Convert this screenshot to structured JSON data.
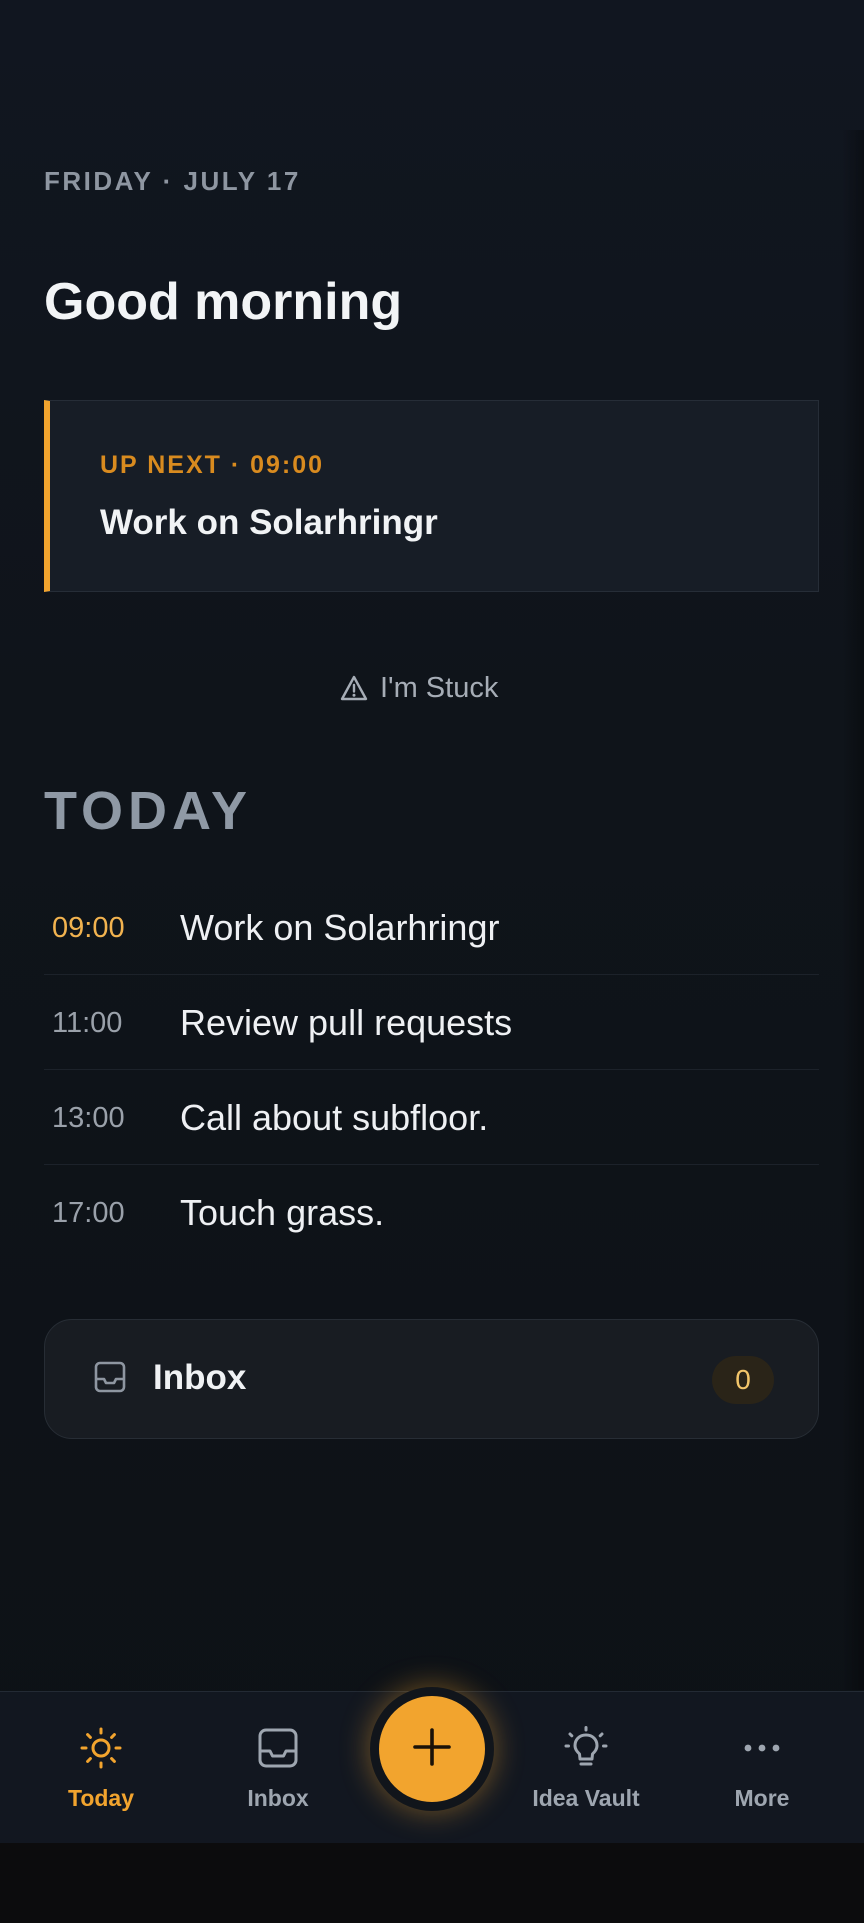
{
  "header": {
    "date": "FRIDAY · JULY 17",
    "greeting": "Good morning"
  },
  "up_next": {
    "label": "UP NEXT · 09:00",
    "title": "Work on Solarhringr"
  },
  "stuck_button": {
    "label": "I'm Stuck",
    "icon": "warning-triangle-icon"
  },
  "today": {
    "heading": "TODAY",
    "items": [
      {
        "time": "09:00",
        "title": "Work on Solarhringr",
        "current": true
      },
      {
        "time": "11:00",
        "title": "Review pull requests",
        "current": false
      },
      {
        "time": "13:00",
        "title": "Call about subfloor.",
        "current": false
      },
      {
        "time": "17:00",
        "title": "Touch grass.",
        "current": false
      }
    ]
  },
  "inbox_card": {
    "label": "Inbox",
    "count": "0",
    "icon": "inbox-tray-icon"
  },
  "nav": {
    "items": [
      {
        "label": "Today",
        "icon": "sun-icon",
        "active": true
      },
      {
        "label": "Inbox",
        "icon": "inbox-tray-icon",
        "active": false
      },
      {
        "label": "Idea Vault",
        "icon": "lightbulb-icon",
        "active": false
      },
      {
        "label": "More",
        "icon": "more-dots-icon",
        "active": false
      }
    ],
    "fab_icon": "plus-icon"
  },
  "colors": {
    "accent": "#f2a42e",
    "background": "#0f141a",
    "card": "#171d26",
    "muted_text": "#8e96a1"
  }
}
